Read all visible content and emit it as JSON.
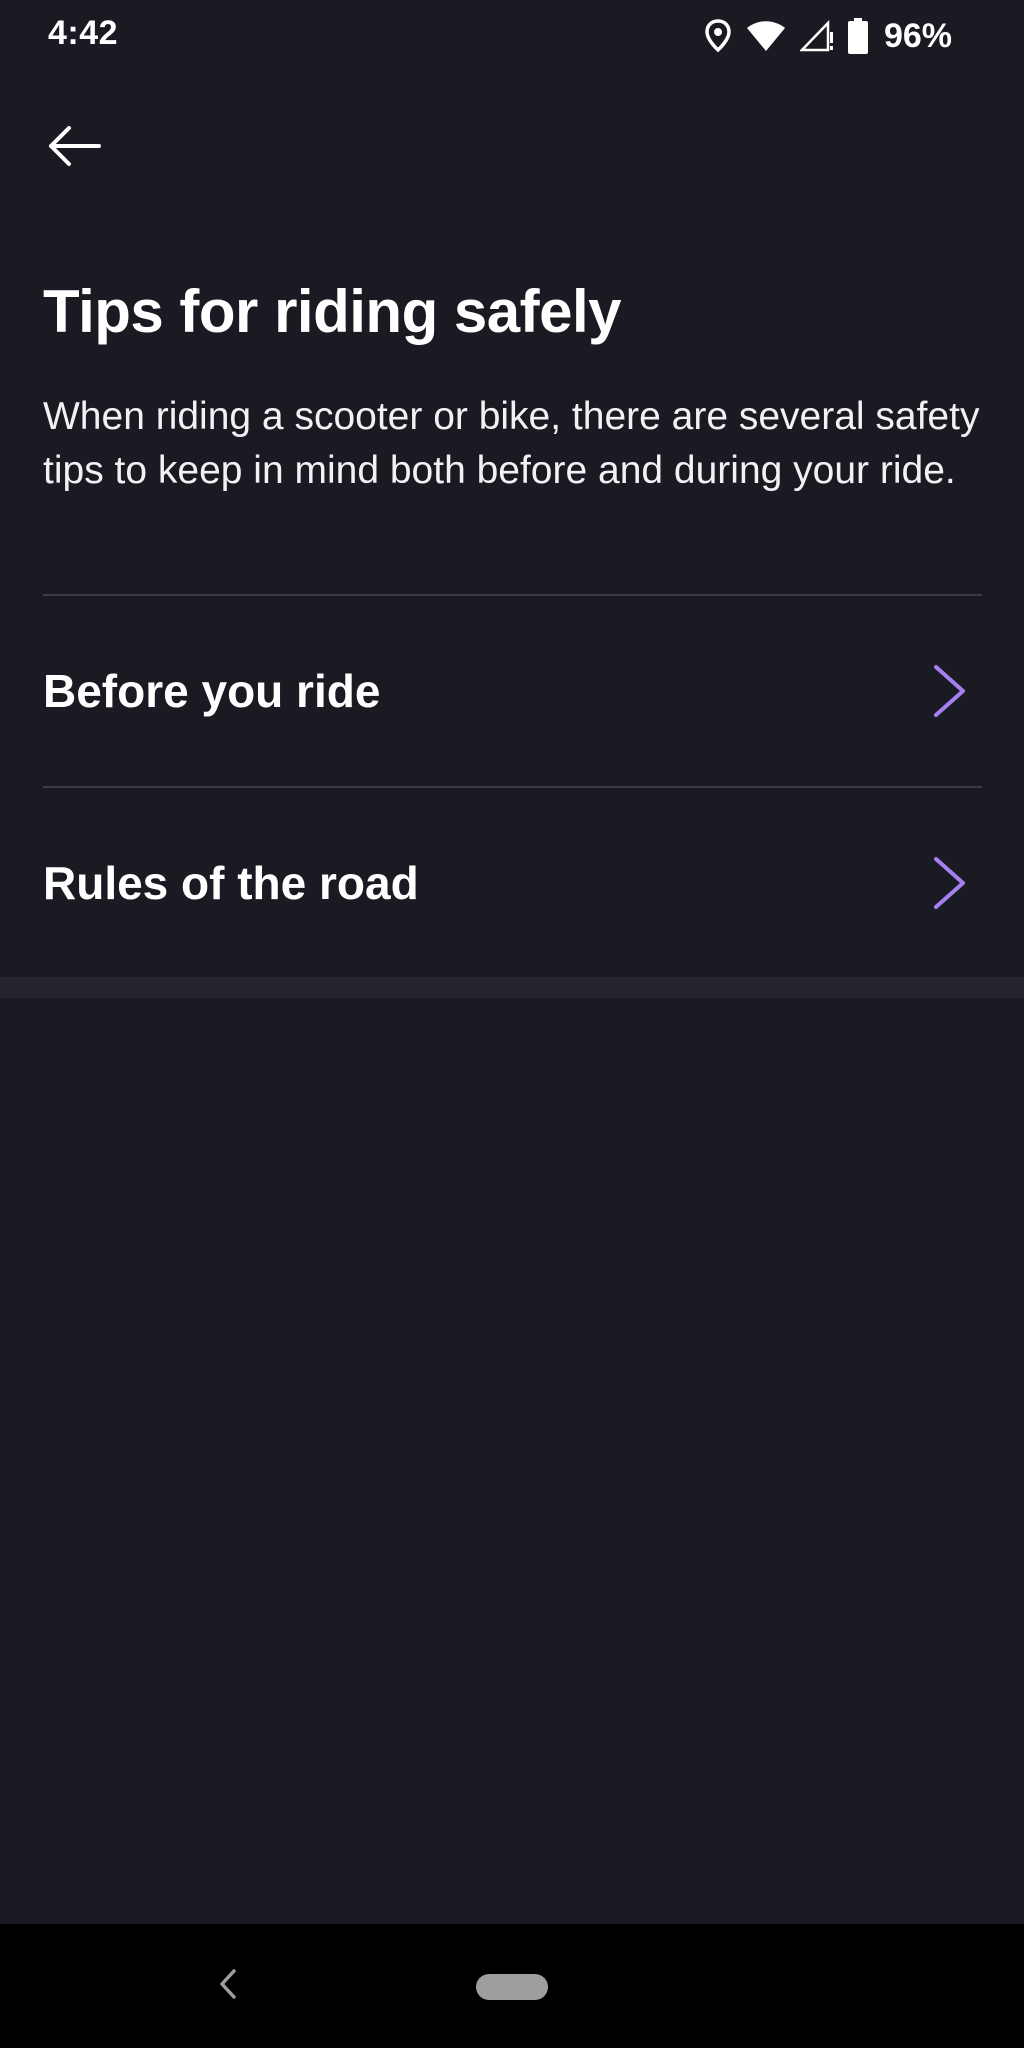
{
  "status_bar": {
    "time": "4:42",
    "battery_percent": "96%",
    "icons": [
      "location-icon",
      "wifi-icon",
      "cell-signal-icon",
      "battery-icon"
    ]
  },
  "header": {
    "back_icon": "back-arrow-icon"
  },
  "main": {
    "title": "Tips for riding safely",
    "intro": "When riding a scooter or bike, there are several safety tips to keep in mind both before and during your ride.",
    "items": [
      {
        "label": "Before you ride",
        "icon": "chevron-right-icon"
      },
      {
        "label": "Rules of the road",
        "icon": "chevron-right-icon"
      }
    ]
  },
  "navigation_bar": {
    "back_icon": "nav-back-icon",
    "home_icon": "home-pill-icon"
  },
  "colors": {
    "background": "#191a22",
    "accent": "#a57ff0",
    "divider": "#3a3b44",
    "text": "#ffffff"
  }
}
